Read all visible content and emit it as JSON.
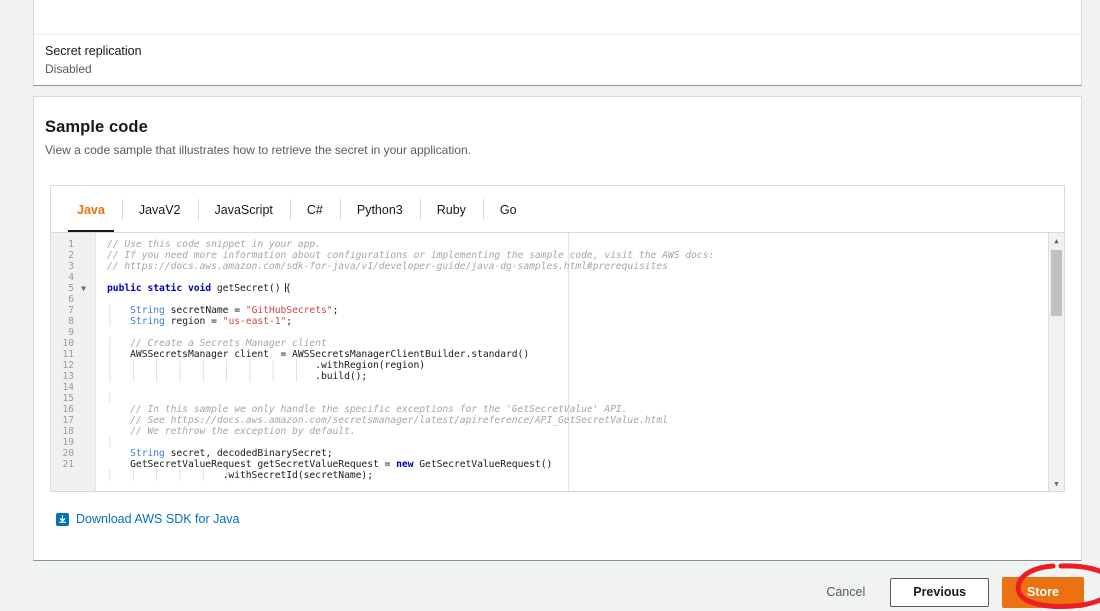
{
  "replication": {
    "label": "Secret replication",
    "value": "Disabled"
  },
  "sample_code": {
    "title": "Sample code",
    "description": "View a code sample that illustrates how to retrieve the secret in your application.",
    "tabs": [
      {
        "label": "Java",
        "active": true
      },
      {
        "label": "JavaV2",
        "active": false
      },
      {
        "label": "JavaScript",
        "active": false
      },
      {
        "label": "C#",
        "active": false
      },
      {
        "label": "Python3",
        "active": false
      },
      {
        "label": "Ruby",
        "active": false
      },
      {
        "label": "Go",
        "active": false
      }
    ],
    "download_label": "Download AWS SDK for Java",
    "download_icon": "download-icon",
    "editor": {
      "language": "Java",
      "first_visible_line": 1,
      "last_visible_line": 21,
      "scrollbar": {
        "up_icon": "caret-up-icon",
        "down_icon": "caret-down-icon"
      },
      "lines": [
        {
          "n": 1,
          "text": "// Use this code snippet in your app."
        },
        {
          "n": 2,
          "text": "// If you need more information about configurations or implementing the sample code, visit the AWS docs:"
        },
        {
          "n": 3,
          "text": "// https://docs.aws.amazon.com/sdk-for-java/v1/developer-guide/java-dg-samples.html#prerequisites"
        },
        {
          "n": 4,
          "text": ""
        },
        {
          "n": 5,
          "text": "public static void getSecret() {"
        },
        {
          "n": 6,
          "text": ""
        },
        {
          "n": 7,
          "text": "    String secretName = \"GitHubSecrets\";"
        },
        {
          "n": 8,
          "text": "    String region = \"us-east-1\";"
        },
        {
          "n": 9,
          "text": ""
        },
        {
          "n": 10,
          "text": "    // Create a Secrets Manager client"
        },
        {
          "n": 11,
          "text": "    AWSSecretsManager client  = AWSSecretsManagerClientBuilder.standard()"
        },
        {
          "n": 12,
          "text": "                                    .withRegion(region)"
        },
        {
          "n": 13,
          "text": "                                    .build();"
        },
        {
          "n": 14,
          "text": ""
        },
        {
          "n": 15,
          "text": "    // In this sample we only handle the specific exceptions for the 'GetSecretValue' API."
        },
        {
          "n": 16,
          "text": "    // See https://docs.aws.amazon.com/secretsmanager/latest/apireference/API_GetSecretValue.html"
        },
        {
          "n": 17,
          "text": "    // We rethrow the exception by default."
        },
        {
          "n": 18,
          "text": ""
        },
        {
          "n": 19,
          "text": "    String secret, decodedBinarySecret;"
        },
        {
          "n": 20,
          "text": "    GetSecretValueRequest getSecretValueRequest = new GetSecretValueRequest()"
        },
        {
          "n": 21,
          "text": "                    .withSecretId(secretName);"
        }
      ]
    }
  },
  "footer": {
    "cancel_label": "Cancel",
    "previous_label": "Previous",
    "store_label": "Store"
  },
  "colors": {
    "accent_orange": "#ec7211",
    "link_blue": "#0073bb",
    "annotation_red": "#ee1c25",
    "page_background": "#f1f3f3"
  }
}
